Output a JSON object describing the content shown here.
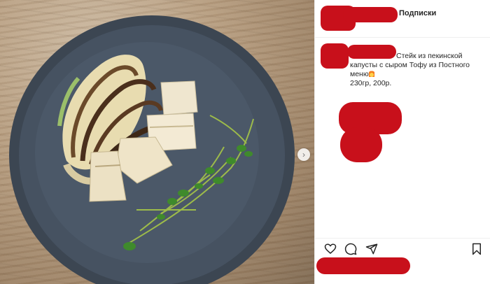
{
  "header": {
    "follow_label": "Подписки"
  },
  "post": {
    "caption_line1": "Стейк из пекинской",
    "caption_line2": "капусты с сыром Тофу из Постного",
    "caption_line3": "меню",
    "caption_line4": "230гр, 200р."
  },
  "photo": {
    "next_symbol": "›"
  },
  "icons": {
    "like": "heart-icon",
    "comment": "comment-icon",
    "share": "send-icon",
    "save": "bookmark-icon"
  },
  "colors": {
    "redaction": "#c8101b",
    "text": "#262626",
    "border": "#efefef"
  }
}
